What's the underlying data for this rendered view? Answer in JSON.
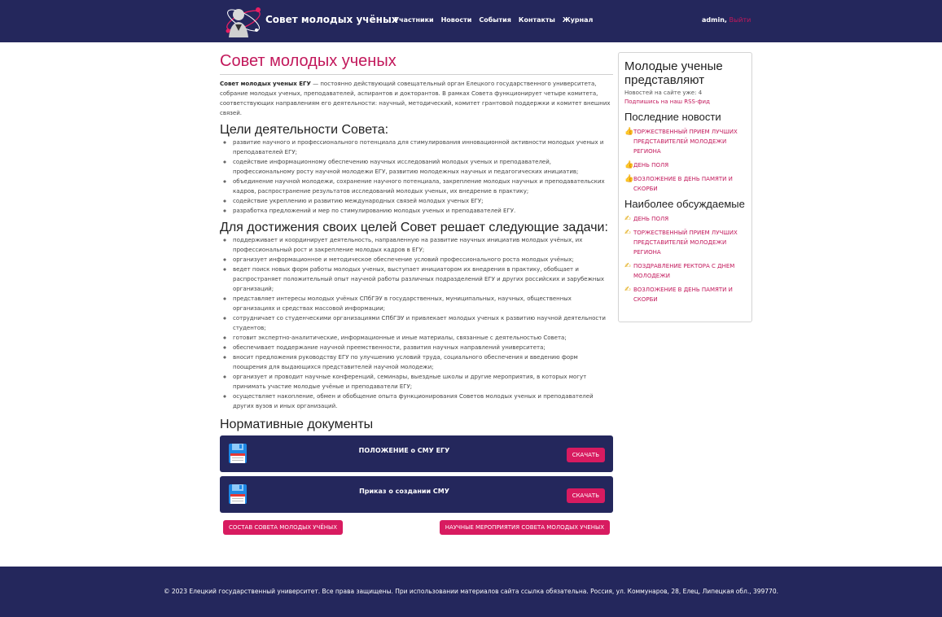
{
  "header": {
    "brand": "Совет молодых учёных",
    "nav": [
      "Участники",
      "Новости",
      "События",
      "Контакты",
      "Журнал"
    ],
    "user": "admin,",
    "logout": "Выйти"
  },
  "main": {
    "title": "Совет молодых ученых",
    "intro_bold": "Совет молодых ученых ЕГУ",
    "intro_text": " — постоянно действующий совещательный орган Елецкого государственного университета, собрание молодых ученых, преподавателей, аспирантов и докторантов. В рамках Совета функционирует четыре комитета, соответствующих направлениям его деятельности: научный, методический, комитет грантовой поддержки и комитет внешних связей.",
    "goals_title": "Цели деятельности Совета:",
    "goals": [
      "развитие научного и профессионального потенциала для стимулирования инновационной активности молодых ученых и преподавателей ЕГУ;",
      "содействие информационному обеспечению научных исследований молодых ученых и преподавателей, профессиональному росту научной молодежи ЕГУ, развитию молодежных научных и педагогических инициатив;",
      "объединение научной молодежи, сохранение научного потенциала, закрепление молодых научных и преподавательских кадров, распространение результатов исследований молодых ученых, их внедрение в практику;",
      "содействие укреплению и развитию международных связей молодых ученых ЕГУ;",
      "разработка предложений и мер по стимулированию молодых ученых и преподавателей ЕГУ."
    ],
    "tasks_title": "Для достижения своих целей Совет решает следующие задачи:",
    "tasks": [
      "поддерживает и координирует деятельность, направленную на развитие научных инициатив молодых учёных, их профессиональный рост и закрепление молодых кадров в ЕГУ;",
      "организует информационное и методическое обеспечение условий профессионального роста молодых учёных;",
      "ведет поиск новых форм работы молодых ученых, выступает инициатором их внедрения в практику, обобщает и распространяет положительный опыт научной работы различных подразделений ЕГУ и других российских и зарубежных организаций;",
      "представляет интересы молодых учёных СПбГЭУ в государственных, муниципальных, научных, общественных организациях и средствах массовой информации;",
      "сотрудничает со студенческими организациями СПбГЭУ и привлекает молодых ученых к развитию научной деятельности студентов;",
      "готовит экспертно-аналитические, информационные и иные материалы, связанные с деятельностью Совета;",
      "обеспечивает поддержание научной преемственности, развития научных направлений университета;",
      "вносит предложения руководству ЕГУ по улучшению условий труда, социального обеспечения и введению форм поощрения для выдающихся представителей научной молодежи;",
      "организует и проводит научные конференций, семинары, выездные школы и другие мероприятия, в которых могут принимать участие молодые учёные и преподаватели ЕГУ;",
      "осуществляет накопление, обмен и обобщение опыта функционирования Советов молодых ученых и преподавателей других вузов и иных организаций."
    ],
    "docs_title": "Нормативные документы",
    "documents": [
      {
        "title": "ПОЛОЖЕНИЕ о СМУ ЕГУ",
        "button": "СКАЧАТЬ"
      },
      {
        "title": "Приказ о создании СМУ",
        "button": "СКАЧАТЬ"
      }
    ],
    "btn_members": "СОСТАВ СОВЕТА МОЛОДЫХ УЧЁНЫХ",
    "btn_events": "НАУЧНЫЕ МЕРОПРИЯТИЯ СОВЕТА МОЛОДЫХ УЧЕНЫХ"
  },
  "sidebar": {
    "title": "Молодые ученые представляют",
    "count": "Новостей на сайте уже: 4",
    "rss": "Подпишись на наш RSS-фид",
    "latest_title": "Последние новости",
    "latest_icon": "thumbs-up-icon",
    "latest": [
      "ТОРЖЕСТВЕННЫЙ ПРИЕМ ЛУЧШИХ ПРЕДСТАВИТЕЛЕЙ МОЛОДЕЖИ РЕГИОНА",
      "ДЕНЬ ПОЛЯ",
      "ВОЗЛОЖЕНИЕ В ДЕНЬ ПАМЯТИ И СКОРБИ"
    ],
    "popular_title": "Наиболее обсуждаемые",
    "popular_icon": "writing-hand-icon",
    "popular": [
      "ДЕНЬ ПОЛЯ",
      "ТОРЖЕСТВЕННЫЙ ПРИЕМ ЛУЧШИХ ПРЕДСТАВИТЕЛЕЙ МОЛОДЕЖИ РЕГИОНА",
      "ПОЗДРАВЛЕНИЕ РЕКТОРА С ДНЕМ МОЛОДЕЖИ",
      "ВОЗЛОЖЕНИЕ В ДЕНЬ ПАМЯТИ И СКОРБИ"
    ]
  },
  "footer": {
    "text": "© 2023 Елецкий государственный университет. Все права защищены. При использовании материалов сайта ссылка обязательна. Россия, ул. Коммунаров, 28, Елец, Липецкая обл., 399770."
  },
  "colors": {
    "navy": "#24275c",
    "accent": "#d81b60",
    "link": "#c2185b"
  }
}
